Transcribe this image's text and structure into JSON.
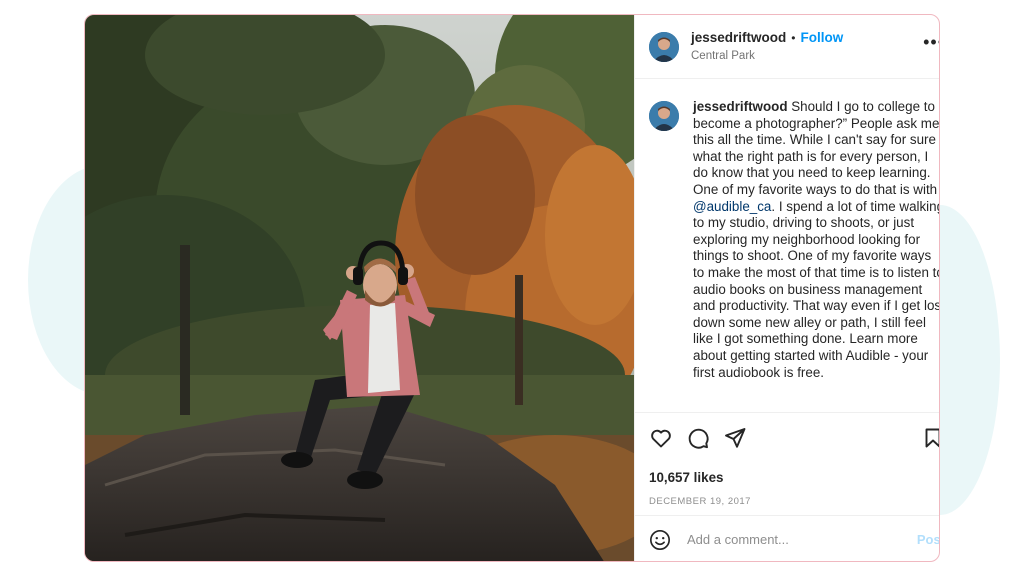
{
  "post": {
    "username": "jessedriftwood",
    "follow_label": "Follow",
    "separator": "•",
    "location": "Central Park",
    "more_label": "•••",
    "caption": {
      "username": "jessedriftwood",
      "text_before_mention": "Should I go to college to become a photographer?” People ask me this all the time. While I can't say for sure what the right path is for every person, I do know that you need to keep learning. One of my favorite ways to do that is with ",
      "mention": "@audible_ca",
      "text_after_mention": ". I spend a lot of time walking to my studio, driving to shoots, or just exploring my neighborhood looking for things to shoot. One of my favorite ways to make the most of that time is to listen to audio books on business management and productivity. That way even if I get lost down some new alley or path, I still feel like I got something done. Learn more about getting started with Audible - your first audiobook is free."
    },
    "likes": "10,657 likes",
    "date": "DECEMBER 19, 2017",
    "comment_placeholder": "Add a comment...",
    "post_label": "Post"
  },
  "icons": {
    "like": "heart-icon",
    "comment": "comment-icon",
    "share": "share-icon",
    "save": "bookmark-icon",
    "emoji": "emoji-icon"
  },
  "colors": {
    "follow": "#0095f6",
    "post_disabled": "#b2dffc",
    "card_border": "#f0b8c0",
    "mention": "#00376b"
  }
}
